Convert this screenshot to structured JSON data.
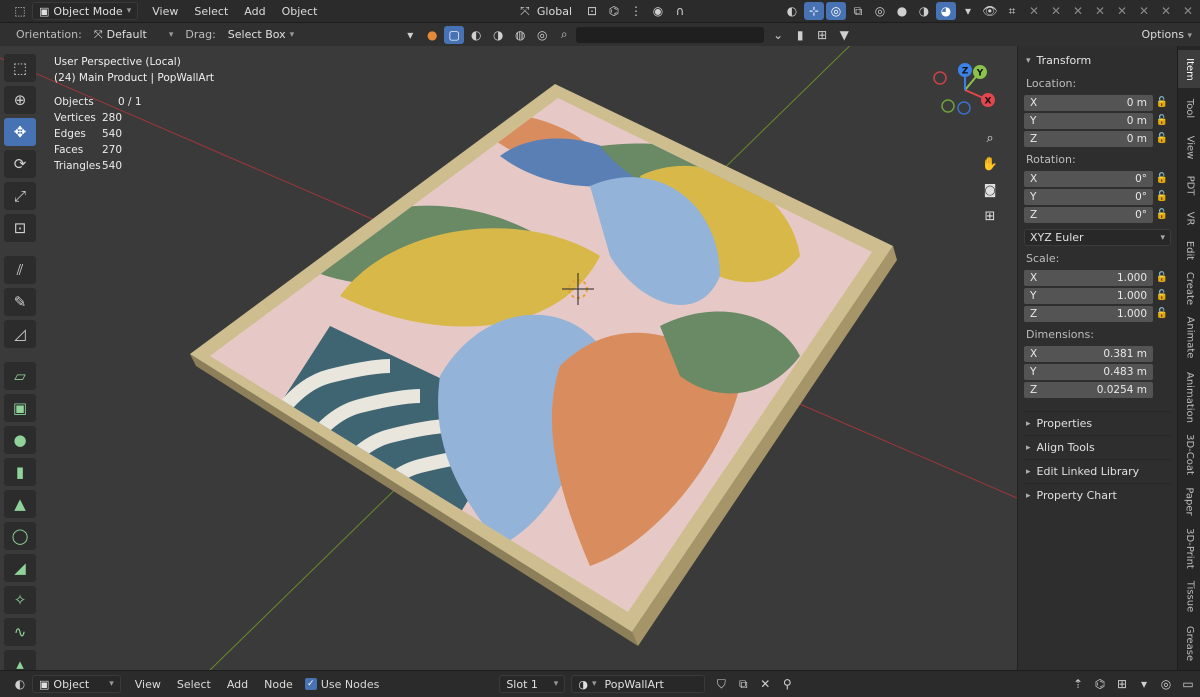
{
  "top_header": {
    "mode": "Object Mode",
    "menus": [
      "View",
      "Select",
      "Add",
      "Object"
    ],
    "transform_orientation": "Global"
  },
  "tool_header": {
    "orientation_label": "Orientation:",
    "orientation_value": "Default",
    "drag_label": "Drag:",
    "drag_value": "Select Box",
    "options_label": "Options"
  },
  "viewport": {
    "view_name": "User Perspective (Local)",
    "object_info": "(24) Main Product | PopWallArt",
    "stats": [
      {
        "label": "Objects",
        "value": "0 / 1"
      },
      {
        "label": "Vertices",
        "value": "280"
      },
      {
        "label": "Edges",
        "value": "540"
      },
      {
        "label": "Faces",
        "value": "270"
      },
      {
        "label": "Triangles",
        "value": "540"
      }
    ],
    "gizmo": {
      "x": "X",
      "y": "Y",
      "z": "Z"
    }
  },
  "n_panel": {
    "transform_title": "Transform",
    "location_label": "Location:",
    "location": [
      {
        "axis": "X",
        "value": "0 m"
      },
      {
        "axis": "Y",
        "value": "0 m"
      },
      {
        "axis": "Z",
        "value": "0 m"
      }
    ],
    "rotation_label": "Rotation:",
    "rotation": [
      {
        "axis": "X",
        "value": "0°"
      },
      {
        "axis": "Y",
        "value": "0°"
      },
      {
        "axis": "Z",
        "value": "0°"
      }
    ],
    "rotation_mode": "XYZ Euler",
    "scale_label": "Scale:",
    "scale": [
      {
        "axis": "X",
        "value": "1.000"
      },
      {
        "axis": "Y",
        "value": "1.000"
      },
      {
        "axis": "Z",
        "value": "1.000"
      }
    ],
    "dimensions_label": "Dimensions:",
    "dimensions": [
      {
        "axis": "X",
        "value": "0.381 m"
      },
      {
        "axis": "Y",
        "value": "0.483 m"
      },
      {
        "axis": "Z",
        "value": "0.0254 m"
      }
    ],
    "panels": [
      "Properties",
      "Align Tools",
      "Edit Linked Library",
      "Property Chart"
    ]
  },
  "side_tabs": [
    "Item",
    "Tool",
    "View",
    "PDT",
    "VR",
    "Edit",
    "Create",
    "Animate",
    "Animation",
    "3D-Coat",
    "Paper",
    "3D-Print",
    "Tissue",
    "Grease"
  ],
  "bottom_header": {
    "mode": "Object",
    "menus": [
      "View",
      "Select",
      "Add",
      "Node"
    ],
    "use_nodes_label": "Use Nodes",
    "slot": "Slot 1",
    "material_name": "PopWallArt"
  },
  "colors": {
    "accent": "#4772b3",
    "frame": "#c8b88a",
    "canvas_pink": "#e6c9c6",
    "leaf_yellow": "#d9b84a",
    "leaf_blue": "#93b3d8",
    "leaf_orange": "#d98c5e",
    "leaf_green": "#6a8a66",
    "stripe_teal": "#3f6472"
  }
}
